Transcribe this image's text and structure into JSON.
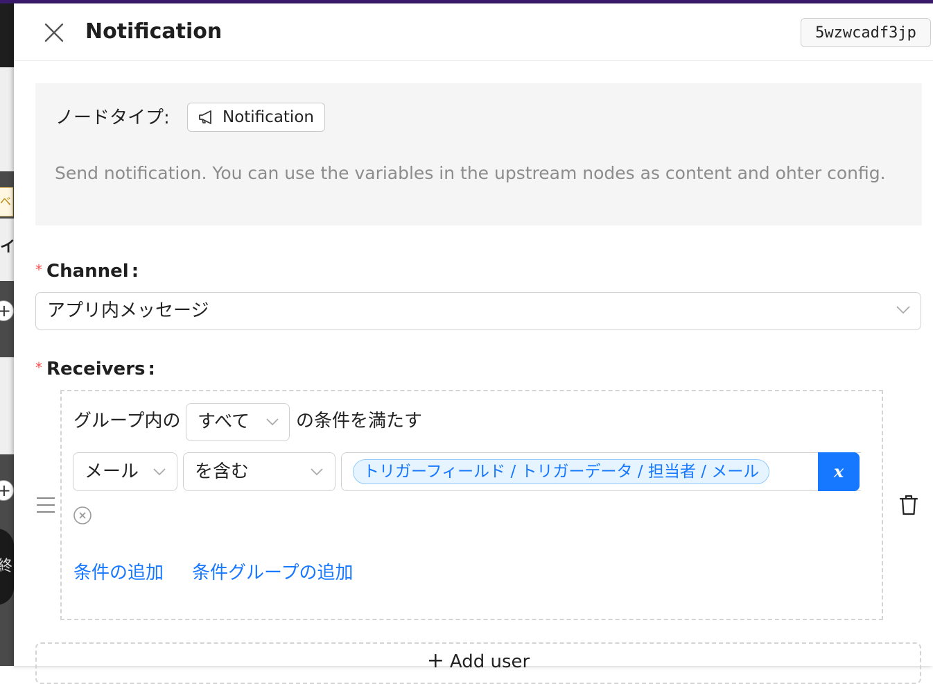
{
  "drawer": {
    "title": "Notification",
    "node_id": "5wzwcadf3jp",
    "close_icon": "close-icon"
  },
  "info": {
    "node_type_label": "ノードタイプ:",
    "node_type_value": "Notification",
    "node_type_icon": "megaphone-icon",
    "description": "Send notification. You can use the variables in the upstream nodes as content and ohter config."
  },
  "channel": {
    "label": "Channel",
    "colon": ":",
    "required_mark": "*",
    "value": "アプリ内メッセージ"
  },
  "receivers": {
    "label": "Receivers",
    "colon": ":",
    "required_mark": "*",
    "group_prefix": "グループ内の",
    "group_logic": "すべて",
    "group_suffix": "の条件を満たす",
    "condition": {
      "field": "メール",
      "operator": "を含む",
      "value_tag": "トリガーフィールド / トリガーデータ / 担当者 / メール",
      "variable_button": "x"
    },
    "add_condition": "条件の追加",
    "add_condition_group": "条件グループの追加"
  },
  "add_user": {
    "plus": "+",
    "label": "Add user"
  },
  "backdrop": {
    "tag_text": "ベン",
    "char_1": "イ",
    "char_2": "終"
  },
  "colors": {
    "primary": "#1677ff",
    "required": "#ff4d4f",
    "tag_bg": "#e6f4ff",
    "tag_border": "#91caff",
    "info_bg": "#f5f5f5",
    "top_bar": "#3b1b6e"
  }
}
